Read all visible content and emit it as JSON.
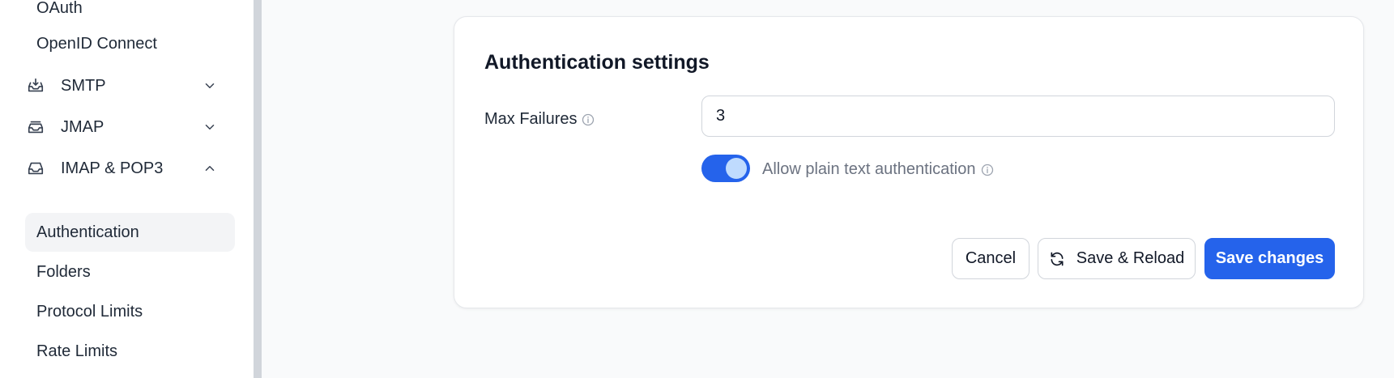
{
  "sidebar": {
    "top_items": [
      {
        "label": "OAuth"
      },
      {
        "label": "OpenID Connect"
      }
    ],
    "groups": [
      {
        "label": "SMTP",
        "icon": "inbox-in-icon",
        "expanded": false
      },
      {
        "label": "JMAP",
        "icon": "inbox-stack-icon",
        "expanded": false
      },
      {
        "label": "IMAP & POP3",
        "icon": "inbox-icon",
        "expanded": true
      }
    ],
    "imap_items": [
      {
        "label": "Authentication",
        "active": true
      },
      {
        "label": "Folders"
      },
      {
        "label": "Protocol Limits"
      },
      {
        "label": "Rate Limits"
      }
    ]
  },
  "card": {
    "title": "Authentication settings",
    "max_failures_label": "Max Failures",
    "max_failures_value": "3",
    "plain_text_label": "Allow plain text authentication",
    "plain_text_enabled": true
  },
  "buttons": {
    "cancel": "Cancel",
    "save_reload": "Save & Reload",
    "save_changes": "Save changes"
  },
  "colors": {
    "accent": "#2563eb",
    "toggle_knob": "#bfdbfe",
    "active_item_bg": "#f3f4f6"
  }
}
